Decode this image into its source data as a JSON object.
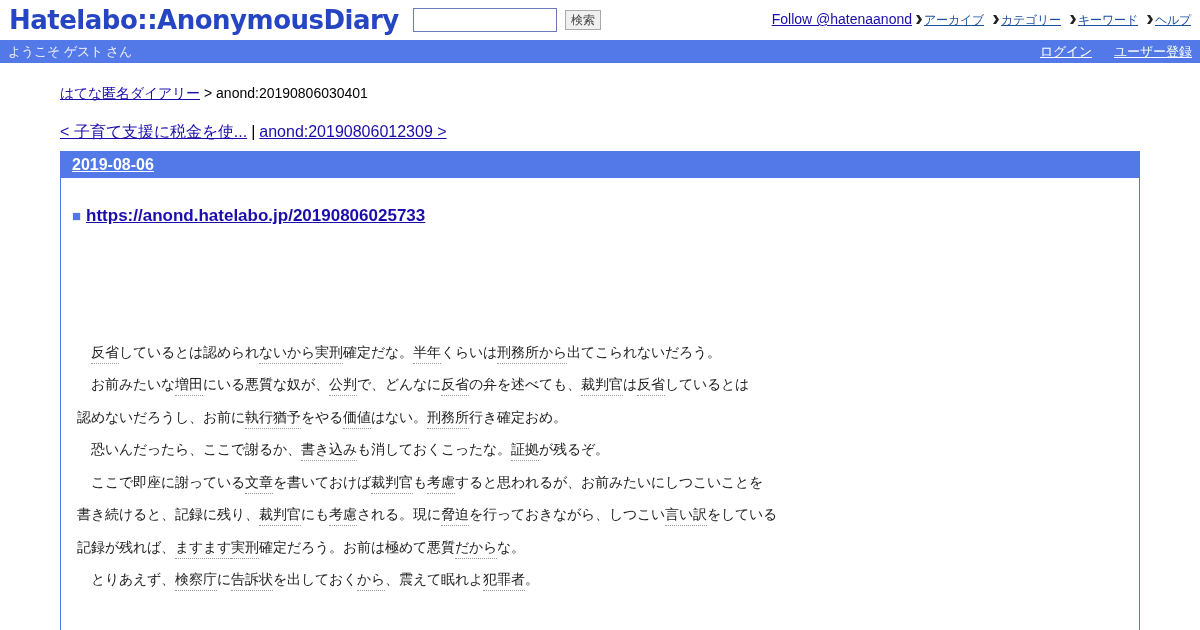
{
  "header": {
    "logo": "Hatelabo::AnonymousDiary",
    "search": {
      "button": "検索"
    },
    "follow": "Follow @hatenaanond",
    "links": [
      "アーカイブ",
      "カテゴリー",
      "キーワード",
      "ヘルプ"
    ]
  },
  "bar": {
    "welcome": "ようこそ ゲスト さん",
    "links": [
      "ログイン",
      "ユーザー登録"
    ]
  },
  "breadcrumb": {
    "link": "はてな匿名ダイアリー",
    "current": "> anond:20190806030401"
  },
  "pager": {
    "prev": "< 子育て支援に税金を使...",
    "separator": "|",
    "next": "anond:20190806012309 >"
  },
  "day": {
    "date": "2019-08-06",
    "section_mark": "■",
    "title": "https://anond.hatelabo.jp/20190806025733",
    "lines": [
      {
        "indented": true,
        "parts": [
          {
            "kind": "keyword",
            "text": "反省"
          },
          {
            "kind": "plain",
            "text": "していると"
          },
          {
            "kind": "plain",
            "text": "は認められ"
          },
          {
            "kind": "keyword",
            "text": "ないから"
          },
          {
            "kind": "keyword",
            "text": "実刑"
          },
          {
            "kind": "plain",
            "text": "確定だな。"
          },
          {
            "kind": "keyword",
            "text": "半年"
          },
          {
            "kind": "plain",
            "text": "くらいは"
          },
          {
            "kind": "keyword",
            "text": "刑務所から"
          },
          {
            "kind": "plain",
            "text": "出てこられないだろう。"
          }
        ]
      },
      {
        "indented": true,
        "parts": [
          {
            "kind": "plain",
            "text": "お前みたいな"
          },
          {
            "kind": "keyword",
            "text": "増田"
          },
          {
            "kind": "plain",
            "text": "にいる悪質な奴が、"
          },
          {
            "kind": "keyword",
            "text": "公判"
          },
          {
            "kind": "plain",
            "text": "で、どんなに"
          },
          {
            "kind": "keyword",
            "text": "反省"
          },
          {
            "kind": "plain",
            "text": "の弁を述べても、"
          },
          {
            "kind": "keyword",
            "text": "裁判官"
          },
          {
            "kind": "plain",
            "text": "は"
          },
          {
            "kind": "keyword",
            "text": "反省"
          },
          {
            "kind": "plain",
            "text": "しているとは"
          }
        ]
      },
      {
        "indented": false,
        "parts": [
          {
            "kind": "plain",
            "text": "認めないだろうし、お前に"
          },
          {
            "kind": "keyword",
            "text": "執行猶予"
          },
          {
            "kind": "plain",
            "text": "をやる"
          },
          {
            "kind": "keyword",
            "text": "価値"
          },
          {
            "kind": "plain",
            "text": "はない。"
          },
          {
            "kind": "keyword",
            "text": "刑務所"
          },
          {
            "kind": "plain",
            "text": "行き確定おめ。"
          }
        ]
      },
      {
        "indented": true,
        "parts": [
          {
            "kind": "plain",
            "text": "恐いんだったら、ここで謝るか、"
          },
          {
            "kind": "keyword",
            "text": "書き込み"
          },
          {
            "kind": "plain",
            "text": "も消しておくこったな。"
          },
          {
            "kind": "keyword",
            "text": "証拠"
          },
          {
            "kind": "plain",
            "text": "が残るぞ。"
          }
        ]
      },
      {
        "indented": true,
        "parts": [
          {
            "kind": "plain",
            "text": "ここで即座に謝っている"
          },
          {
            "kind": "keyword",
            "text": "文章"
          },
          {
            "kind": "plain",
            "text": "を書いておけば"
          },
          {
            "kind": "keyword",
            "text": "裁判官"
          },
          {
            "kind": "plain",
            "text": "も"
          },
          {
            "kind": "keyword",
            "text": "考慮"
          },
          {
            "kind": "plain",
            "text": "すると思われるが、お前みたいにしつこいことを"
          }
        ]
      },
      {
        "indented": false,
        "parts": [
          {
            "kind": "plain",
            "text": "書き続けると、記録に残り、"
          },
          {
            "kind": "keyword",
            "text": "裁判官"
          },
          {
            "kind": "plain",
            "text": "にも"
          },
          {
            "kind": "keyword",
            "text": "考慮"
          },
          {
            "kind": "plain",
            "text": "される。現に"
          },
          {
            "kind": "keyword",
            "text": "脅迫"
          },
          {
            "kind": "plain",
            "text": "を行っておきながら、しつこい"
          },
          {
            "kind": "keyword",
            "text": "言い訳"
          },
          {
            "kind": "plain",
            "text": "をしている"
          }
        ]
      },
      {
        "indented": false,
        "parts": [
          {
            "kind": "plain",
            "text": "記録が残れば、"
          },
          {
            "kind": "keyword",
            "text": "ますます"
          },
          {
            "kind": "keyword",
            "text": "実刑"
          },
          {
            "kind": "plain",
            "text": "確定だろう。お前は極めて悪質"
          },
          {
            "kind": "keyword",
            "text": "だから"
          },
          {
            "kind": "plain",
            "text": "な。"
          }
        ]
      },
      {
        "indented": true,
        "parts": [
          {
            "kind": "plain",
            "text": "とりあえず、"
          },
          {
            "kind": "keyword",
            "text": "検察庁"
          },
          {
            "kind": "plain",
            "text": "に"
          },
          {
            "kind": "keyword",
            "text": "告訴状"
          },
          {
            "kind": "plain",
            "text": "を出しておく"
          },
          {
            "kind": "keyword",
            "text": "から"
          },
          {
            "kind": "plain",
            "text": "、震えて眠れよ"
          },
          {
            "kind": "keyword",
            "text": "犯罪者"
          },
          {
            "kind": "plain",
            "text": "。"
          }
        ]
      }
    ]
  }
}
